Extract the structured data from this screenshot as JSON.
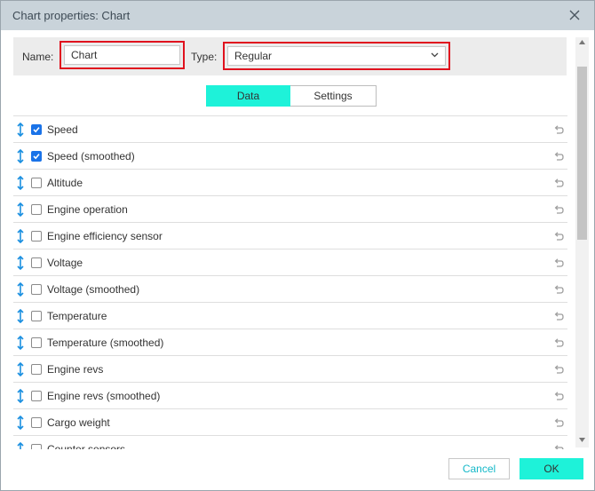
{
  "dialog": {
    "title": "Chart properties: Chart",
    "close_icon": "close-icon"
  },
  "name_field": {
    "label": "Name:",
    "value": "Chart"
  },
  "type_field": {
    "label": "Type:",
    "value": "Regular",
    "icon": "chevron-down-icon"
  },
  "tabs": [
    {
      "label": "Data",
      "active": true
    },
    {
      "label": "Settings",
      "active": false
    }
  ],
  "sensors": [
    {
      "label": "Speed",
      "checked": true
    },
    {
      "label": "Speed (smoothed)",
      "checked": true
    },
    {
      "label": "Altitude",
      "checked": false
    },
    {
      "label": "Engine operation",
      "checked": false
    },
    {
      "label": "Engine efficiency sensor",
      "checked": false
    },
    {
      "label": "Voltage",
      "checked": false
    },
    {
      "label": "Voltage (smoothed)",
      "checked": false
    },
    {
      "label": "Temperature",
      "checked": false
    },
    {
      "label": "Temperature (smoothed)",
      "checked": false
    },
    {
      "label": "Engine revs",
      "checked": false
    },
    {
      "label": "Engine revs (smoothed)",
      "checked": false
    },
    {
      "label": "Cargo weight",
      "checked": false
    },
    {
      "label": "Counter sensors",
      "checked": false
    }
  ],
  "footer": {
    "cancel_label": "Cancel",
    "ok_label": "OK"
  },
  "colors": {
    "accent": "#1ef2d9",
    "highlight_border": "#e0121e",
    "checkbox": "#1a73e8",
    "drag_handle": "#1a8fe0",
    "cancel_text": "#13b8c8"
  }
}
